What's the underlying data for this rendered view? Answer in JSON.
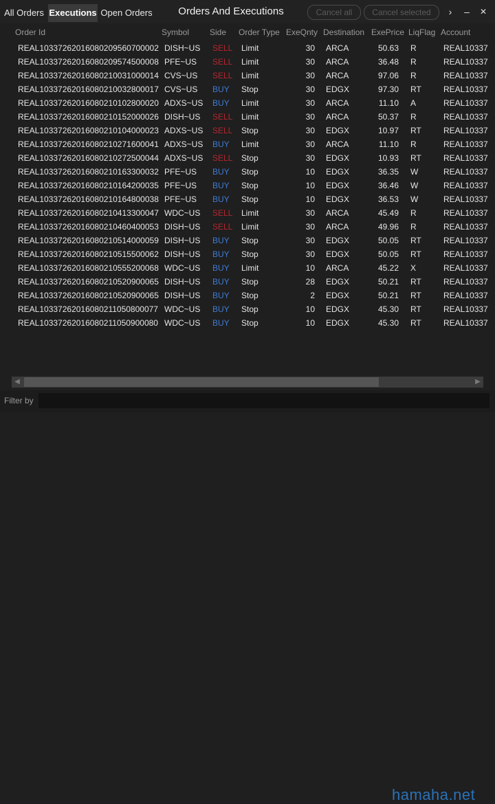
{
  "tabs": [
    "All Orders",
    "Executions",
    "Open Orders"
  ],
  "active_tab": 1,
  "window_title": "Orders And Executions",
  "buttons": {
    "cancel_all": "Cancel all",
    "cancel_selected": "Cancel selected"
  },
  "window_controls": {
    "more_icon": "chevron-right-icon",
    "more": "›",
    "minimize_icon": "minimize-icon",
    "minimize": "‒",
    "close_icon": "close-icon",
    "close": "✕"
  },
  "columns": [
    "Order Id",
    "Symbol",
    "Side",
    "Order Type",
    "ExeQnty",
    "Destination",
    "ExePrice",
    "LiqFlag",
    "Account"
  ],
  "side_colors": {
    "SELL": "#b3262e",
    "BUY": "#3e7bd4"
  },
  "rows": [
    [
      "REAL10337262016080209560700002",
      "DISH~US",
      "SELL",
      "Limit",
      "30",
      "ARCA",
      "50.63",
      "R",
      "REAL10337"
    ],
    [
      "REAL10337262016080209574500008",
      "PFE~US",
      "SELL",
      "Limit",
      "30",
      "ARCA",
      "36.48",
      "R",
      "REAL10337"
    ],
    [
      "REAL10337262016080210031000014",
      "CVS~US",
      "SELL",
      "Limit",
      "30",
      "ARCA",
      "97.06",
      "R",
      "REAL10337"
    ],
    [
      "REAL10337262016080210032800017",
      "CVS~US",
      "BUY",
      "Stop",
      "30",
      "EDGX",
      "97.30",
      "RT",
      "REAL10337"
    ],
    [
      "REAL10337262016080210102800020",
      "ADXS~US",
      "BUY",
      "Limit",
      "30",
      "ARCA",
      "11.10",
      "A",
      "REAL10337"
    ],
    [
      "REAL10337262016080210152000026",
      "DISH~US",
      "SELL",
      "Limit",
      "30",
      "ARCA",
      "50.37",
      "R",
      "REAL10337"
    ],
    [
      "REAL10337262016080210104000023",
      "ADXS~US",
      "SELL",
      "Stop",
      "30",
      "EDGX",
      "10.97",
      "RT",
      "REAL10337"
    ],
    [
      "REAL10337262016080210271600041",
      "ADXS~US",
      "BUY",
      "Limit",
      "30",
      "ARCA",
      "11.10",
      "R",
      "REAL10337"
    ],
    [
      "REAL10337262016080210272500044",
      "ADXS~US",
      "SELL",
      "Stop",
      "30",
      "EDGX",
      "10.93",
      "RT",
      "REAL10337"
    ],
    [
      "REAL10337262016080210163300032",
      "PFE~US",
      "BUY",
      "Stop",
      "10",
      "EDGX",
      "36.35",
      "W",
      "REAL10337"
    ],
    [
      "REAL10337262016080210164200035",
      "PFE~US",
      "BUY",
      "Stop",
      "10",
      "EDGX",
      "36.46",
      "W",
      "REAL10337"
    ],
    [
      "REAL10337262016080210164800038",
      "PFE~US",
      "BUY",
      "Stop",
      "10",
      "EDGX",
      "36.53",
      "W",
      "REAL10337"
    ],
    [
      "REAL10337262016080210413300047",
      "WDC~US",
      "SELL",
      "Limit",
      "30",
      "ARCA",
      "45.49",
      "R",
      "REAL10337"
    ],
    [
      "REAL10337262016080210460400053",
      "DISH~US",
      "SELL",
      "Limit",
      "30",
      "ARCA",
      "49.96",
      "R",
      "REAL10337"
    ],
    [
      "REAL10337262016080210514000059",
      "DISH~US",
      "BUY",
      "Stop",
      "30",
      "EDGX",
      "50.05",
      "RT",
      "REAL10337"
    ],
    [
      "REAL10337262016080210515500062",
      "DISH~US",
      "BUY",
      "Stop",
      "30",
      "EDGX",
      "50.05",
      "RT",
      "REAL10337"
    ],
    [
      "REAL10337262016080210555200068",
      "WDC~US",
      "BUY",
      "Limit",
      "10",
      "ARCA",
      "45.22",
      "X",
      "REAL10337"
    ],
    [
      "REAL10337262016080210520900065",
      "DISH~US",
      "BUY",
      "Stop",
      "28",
      "EDGX",
      "50.21",
      "RT",
      "REAL10337"
    ],
    [
      "REAL10337262016080210520900065",
      "DISH~US",
      "BUY",
      "Stop",
      "2",
      "EDGX",
      "50.21",
      "RT",
      "REAL10337"
    ],
    [
      "REAL10337262016080211050800077",
      "WDC~US",
      "BUY",
      "Stop",
      "10",
      "EDGX",
      "45.30",
      "RT",
      "REAL10337"
    ],
    [
      "REAL10337262016080211050900080",
      "WDC~US",
      "BUY",
      "Stop",
      "10",
      "EDGX",
      "45.30",
      "RT",
      "REAL10337"
    ]
  ],
  "scrollbar": {
    "left_arrow": "◀",
    "right_arrow": "▶"
  },
  "filter": {
    "label": "Filter by",
    "value": "",
    "placeholder": ""
  },
  "watermark": "hamaha.net"
}
